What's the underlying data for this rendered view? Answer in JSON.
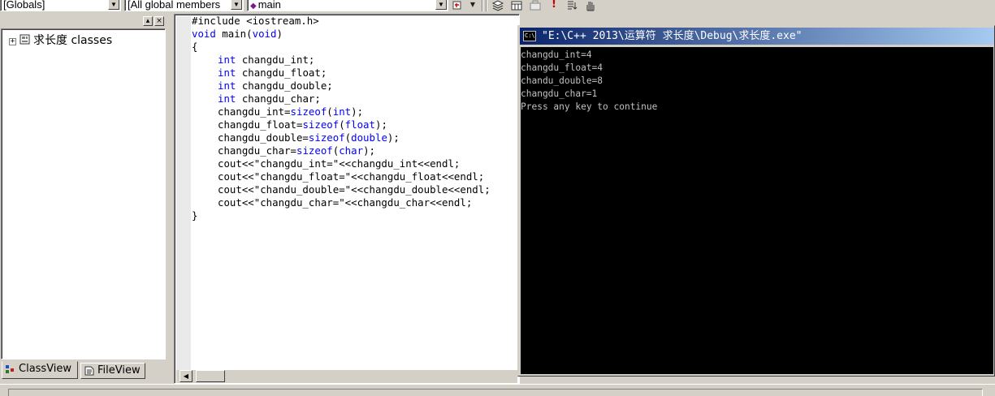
{
  "toolbar": {
    "scope_combo": "[Globals]",
    "filter_combo": "[All global members",
    "function_combo": "main",
    "combo_arrow": "▼"
  },
  "workspace": {
    "tree_root_label": "求长度 classes",
    "tabs": [
      {
        "label": "ClassView"
      },
      {
        "label": "FileView"
      }
    ]
  },
  "editor": {
    "lines": [
      {
        "parts": [
          {
            "t": "#include <iostream.h>",
            "k": false
          }
        ]
      },
      {
        "parts": [
          {
            "t": "void",
            "k": true
          },
          {
            "t": " main(",
            "k": false
          },
          {
            "t": "void",
            "k": true
          },
          {
            "t": ")",
            "k": false
          }
        ]
      },
      {
        "parts": [
          {
            "t": "{",
            "k": false
          }
        ]
      },
      {
        "indent": true,
        "parts": [
          {
            "t": "int",
            "k": true
          },
          {
            "t": " changdu_int;",
            "k": false
          }
        ]
      },
      {
        "indent": true,
        "parts": [
          {
            "t": "int",
            "k": true
          },
          {
            "t": " changdu_float;",
            "k": false
          }
        ]
      },
      {
        "indent": true,
        "parts": [
          {
            "t": "int",
            "k": true
          },
          {
            "t": " changdu_double;",
            "k": false
          }
        ]
      },
      {
        "indent": true,
        "parts": [
          {
            "t": "int",
            "k": true
          },
          {
            "t": " changdu_char;",
            "k": false
          }
        ]
      },
      {
        "indent": true,
        "parts": [
          {
            "t": "changdu_int=",
            "k": false
          },
          {
            "t": "sizeof",
            "k": true
          },
          {
            "t": "(",
            "k": false
          },
          {
            "t": "int",
            "k": true
          },
          {
            "t": ");",
            "k": false
          }
        ]
      },
      {
        "indent": true,
        "parts": [
          {
            "t": "changdu_float=",
            "k": false
          },
          {
            "t": "sizeof",
            "k": true
          },
          {
            "t": "(",
            "k": false
          },
          {
            "t": "float",
            "k": true
          },
          {
            "t": ");",
            "k": false
          }
        ]
      },
      {
        "indent": true,
        "parts": [
          {
            "t": "changdu_double=",
            "k": false
          },
          {
            "t": "sizeof",
            "k": true
          },
          {
            "t": "(",
            "k": false
          },
          {
            "t": "double",
            "k": true
          },
          {
            "t": ");",
            "k": false
          }
        ]
      },
      {
        "indent": true,
        "parts": [
          {
            "t": "changdu_char=",
            "k": false
          },
          {
            "t": "sizeof",
            "k": true
          },
          {
            "t": "(",
            "k": false
          },
          {
            "t": "char",
            "k": true
          },
          {
            "t": ");",
            "k": false
          }
        ]
      },
      {
        "indent": true,
        "parts": [
          {
            "t": "cout<<\"changdu_int=\"<<changdu_int<<endl;",
            "k": false
          }
        ]
      },
      {
        "indent": true,
        "parts": [
          {
            "t": "cout<<\"changdu_float=\"<<changdu_float<<endl;",
            "k": false
          }
        ]
      },
      {
        "indent": true,
        "parts": [
          {
            "t": "cout<<\"chandu_double=\"<<changdu_double<<endl;",
            "k": false
          }
        ]
      },
      {
        "indent": true,
        "parts": [
          {
            "t": "cout<<\"changdu_char=\"<<changdu_char<<endl;",
            "k": false
          }
        ]
      },
      {
        "parts": [
          {
            "t": "}",
            "k": false
          }
        ]
      }
    ]
  },
  "console": {
    "icon_text": "C:\\",
    "title": "\"E:\\C++  2013\\运算符 求长度\\Debug\\求长度.exe\"",
    "output": "changdu_int=4\nchangdu_float=4\nchandu_double=8\nchangdu_char=1\nPress any key to continue"
  },
  "colors": {
    "keyword": "#0000ff",
    "title_gradient_start": "#0a246a",
    "title_gradient_end": "#a6caf0",
    "console_text": "#c0c0c0"
  }
}
